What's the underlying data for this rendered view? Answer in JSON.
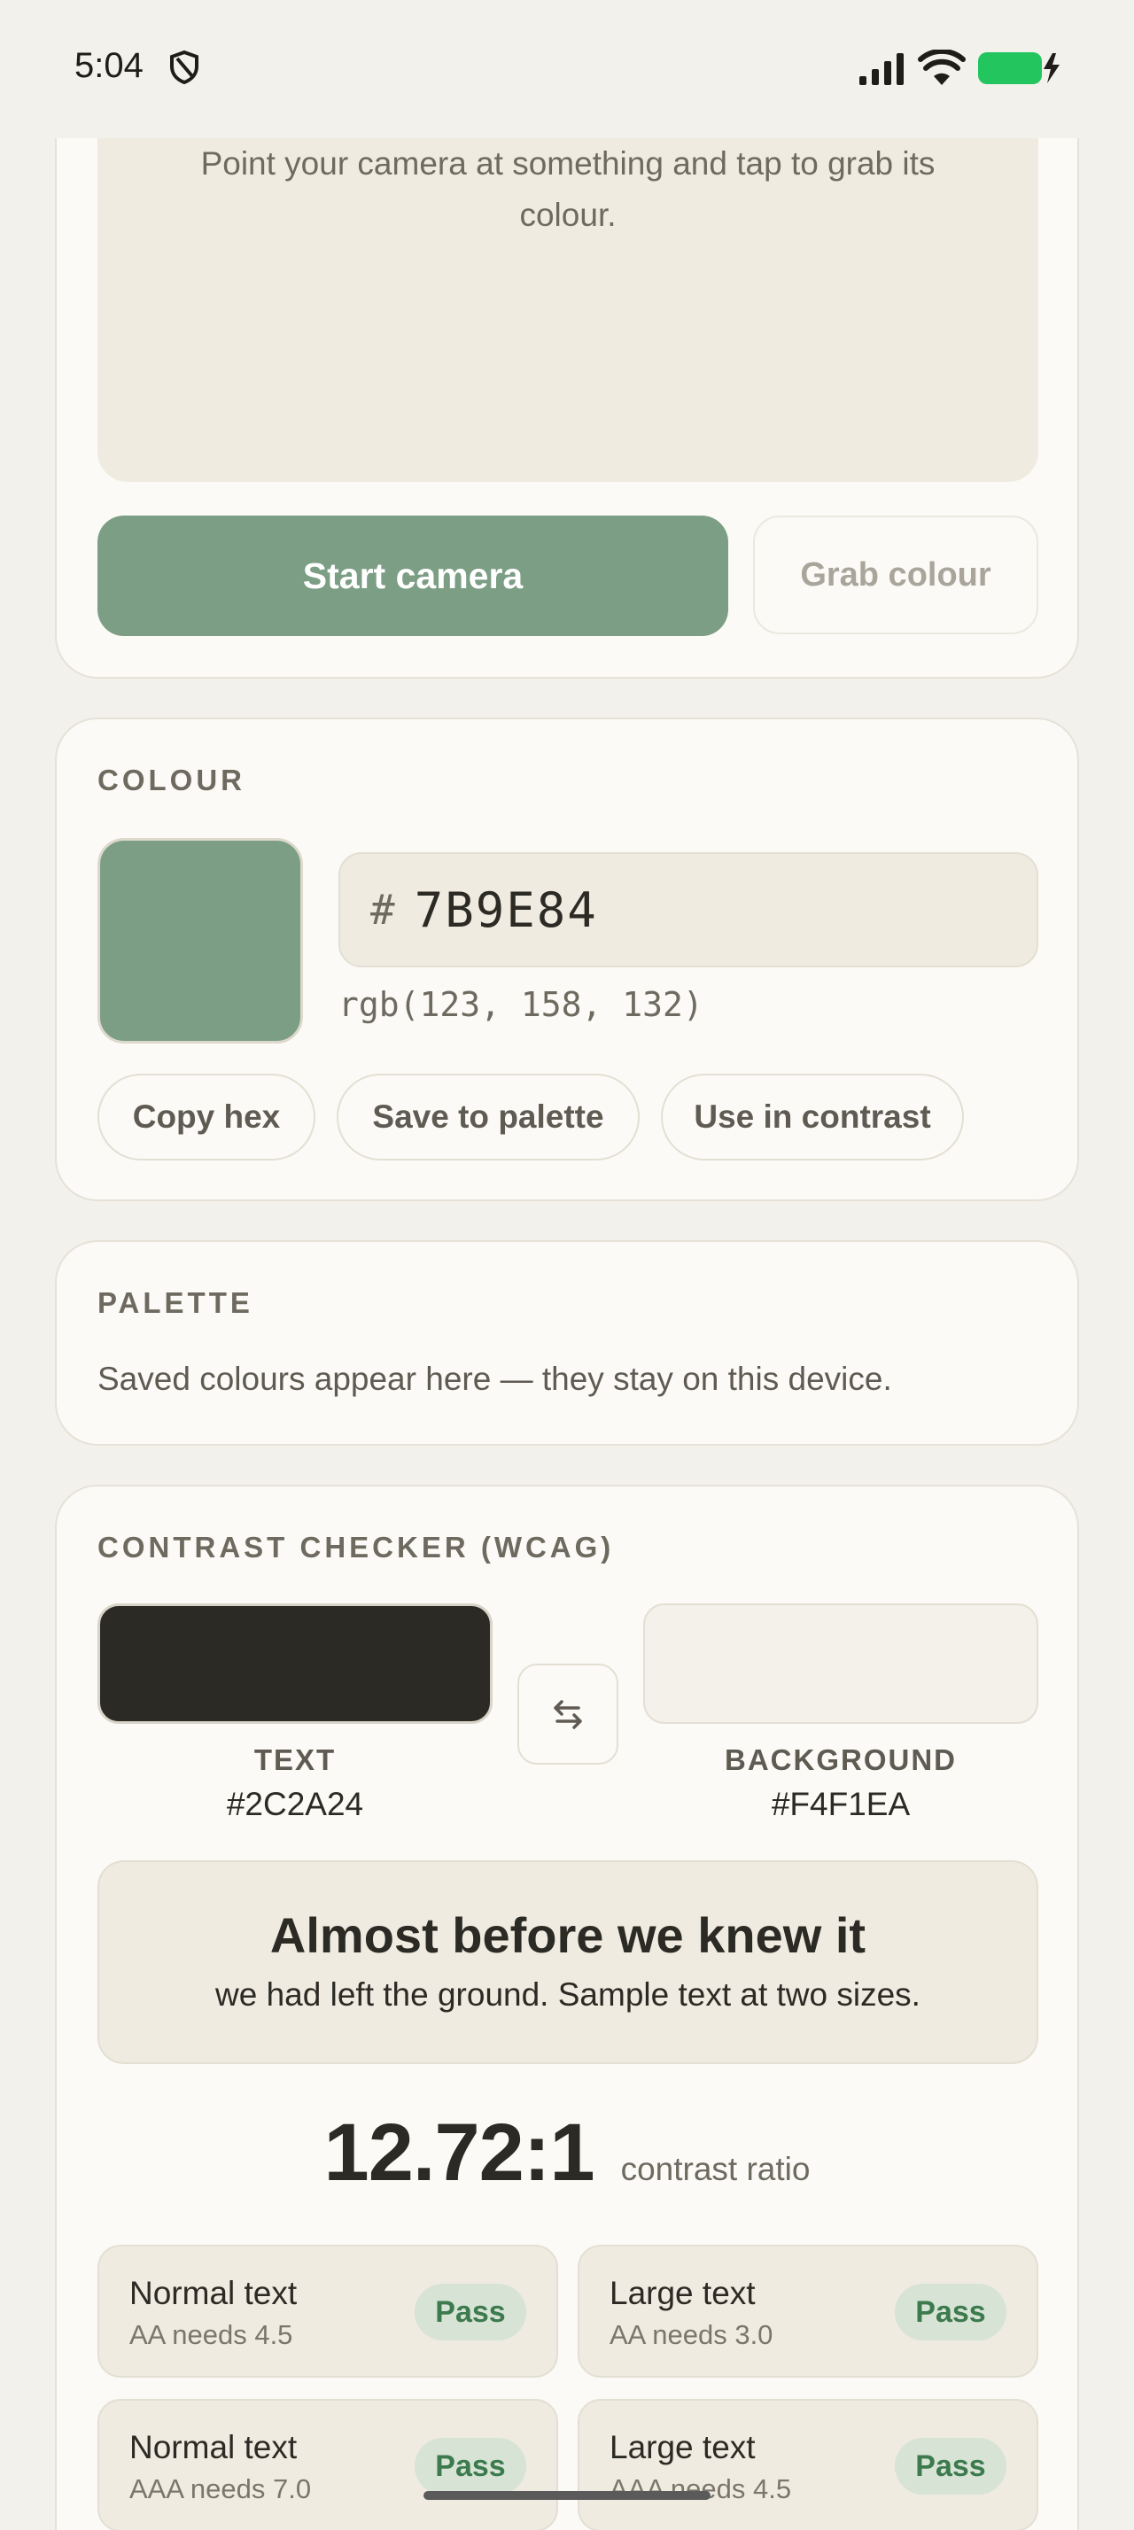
{
  "status_bar": {
    "time": "5:04"
  },
  "camera": {
    "hint": "Point your camera at something and tap to grab its colour.",
    "start_label": "Start camera",
    "grab_label": "Grab colour"
  },
  "colour": {
    "section_label": "COLOUR",
    "swatch_color": "#7B9E84",
    "hash": "#",
    "hex": "7B9E84",
    "rgb": "rgb(123, 158, 132)",
    "copy_label": "Copy hex",
    "save_label": "Save to palette",
    "contrast_label": "Use in contrast"
  },
  "palette": {
    "section_label": "PALETTE",
    "empty_text": "Saved colours appear here — they stay on this device."
  },
  "contrast": {
    "section_label": "CONTRAST CHECKER (WCAG)",
    "text_label": "TEXT",
    "text_hex": "#2C2A24",
    "bg_label": "BACKGROUND",
    "bg_hex": "#F4F1EA",
    "sample_large": "Almost before we knew it",
    "sample_small": "we had left the ground. Sample text at two sizes.",
    "ratio": "12.72:1",
    "ratio_caption": "contrast ratio",
    "results": [
      {
        "title": "Normal text",
        "sub": "AA needs 4.5",
        "status": "Pass"
      },
      {
        "title": "Large text",
        "sub": "AA needs 3.0",
        "status": "Pass"
      },
      {
        "title": "Normal text",
        "sub": "AAA needs 7.0",
        "status": "Pass"
      },
      {
        "title": "Large text",
        "sub": "AAA needs 4.5",
        "status": "Pass"
      }
    ]
  },
  "colors": {
    "accent": "#7B9E84",
    "pass_badge_bg": "#D6E3D5",
    "pass_badge_text": "#3D7A4E",
    "battery": "#22C55E"
  }
}
